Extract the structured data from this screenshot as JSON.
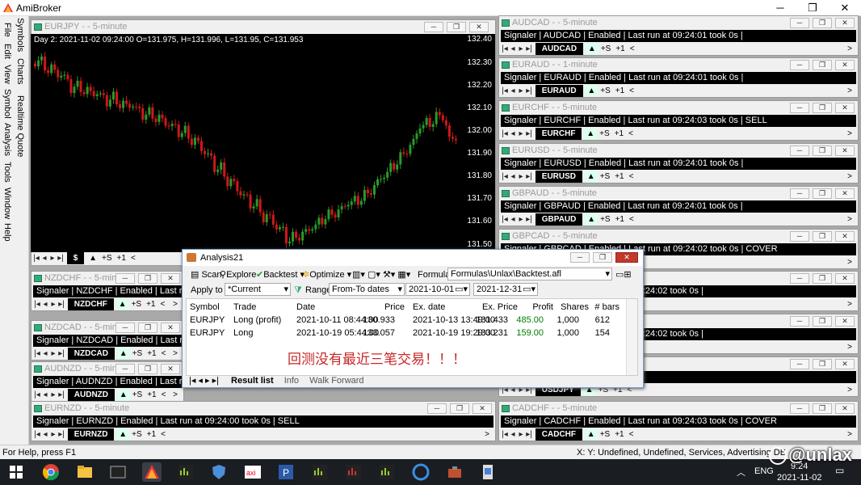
{
  "app": {
    "title": "AmiBroker"
  },
  "sidebar": {
    "tabs": [
      "Symbols",
      "Charts",
      "Realtime Quote"
    ],
    "menu": [
      "File",
      "Edit",
      "View",
      "Symbol",
      "Analysis",
      "Tools",
      "Window",
      "Help"
    ]
  },
  "main_chart": {
    "caption": "EURJPY - - 5-minute",
    "info": "Day 2: 2021-11-02 09:24:00 O=131.975, H=131.996, L=131.95, C=131.953",
    "yticks": [
      "132.40",
      "132.30",
      "132.20",
      "132.10",
      "132.00",
      "131.90",
      "131.80",
      "131.70",
      "131.60",
      "131.50"
    ],
    "nav_symbol": "$"
  },
  "chart_data": {
    "type": "candlestick",
    "title": "EURJPY - - 5-minute",
    "ylim": [
      131.47,
      132.43
    ],
    "close_path": [
      132.3,
      132.33,
      132.25,
      132.3,
      132.22,
      132.26,
      132.18,
      132.22,
      132.16,
      132.2,
      132.14,
      132.18,
      132.12,
      132.17,
      132.1,
      132.14,
      132.09,
      132.12,
      132.06,
      132.1,
      132.04,
      132.08,
      132.0,
      132.05,
      131.98,
      132.02,
      131.94,
      131.98,
      131.88,
      131.92,
      131.82,
      131.86,
      131.76,
      131.8,
      131.7,
      131.74,
      131.66,
      131.7,
      131.6,
      131.65,
      131.55,
      131.6,
      131.5,
      131.56,
      131.52,
      131.58,
      131.55,
      131.62,
      131.6,
      131.66,
      131.62,
      131.68,
      131.66,
      131.72,
      131.68,
      131.75,
      131.72,
      131.8,
      131.78,
      131.86,
      131.84,
      131.92,
      131.9,
      131.98,
      132.0,
      132.06,
      132.02,
      132.1,
      132.04,
      131.98,
      131.95
    ]
  },
  "symbol_windows": [
    {
      "caption": "AUDCAD - - 5-minute",
      "signal": "Signaler | AUDCAD | Enabled | Last run at 09:24:01 took 0s |",
      "sym": "AUDCAD"
    },
    {
      "caption": "EURAUD - - 1-minute",
      "signal": "Signaler | EURAUD | Enabled | Last run at 09:24:01 took 0s |",
      "sym": "EURAUD"
    },
    {
      "caption": "EURCHF - - 5-minute",
      "signal": "Signaler | EURCHF | Enabled | Last run at 09:24:03 took 0s |   SELL",
      "sym": "EURCHF"
    },
    {
      "caption": "EURUSD - - 5-minute",
      "signal": "Signaler | EURUSD | Enabled | Last run at 09:24:01 took 0s |",
      "sym": "EURUSD"
    },
    {
      "caption": "GBPAUD - - 5-minute",
      "signal": "Signaler | GBPAUD | Enabled | Last run at 09:24:01 took 0s |",
      "sym": "GBPAUD"
    },
    {
      "caption": "GBPCAD - - 5-minute",
      "signal": "Signaler | GBPCAD | Enabled | Last run at 09:24:02 took 0s |   COVER",
      "sym": "GBPCAD"
    },
    {
      "caption": "",
      "signal": "Signaler | | Enabled | Last run at 09:24:02 took 0s |",
      "sym": ""
    },
    {
      "caption": "",
      "signal": "Signaler | | Enabled | Last run at 09:24:02 took 0s |",
      "sym": ""
    },
    {
      "caption": "",
      "signal": "at 09:24:00 took 0s |",
      "sym": "USDJPY"
    },
    {
      "caption": "CADCHF - - 5-minute",
      "signal": "Signaler | CADCHF | Enabled | Last run at 09:24:03 took 0s |   COVER",
      "sym": "CADCHF"
    }
  ],
  "left_windows": [
    {
      "caption": "NZDCHF - - 5-minute",
      "signal": "Signaler | NZDCHF | Enabled | Last run",
      "sym": "NZDCHF"
    },
    {
      "caption": "NZDCAD - - 5-minute",
      "signal": "Signaler | NZDCAD | Enabled | Last run",
      "sym": "NZDCAD"
    },
    {
      "caption": "AUDNZD - - 5-minute",
      "signal": "Signaler | AUDNZD | Enabled | Last run",
      "sym": "AUDNZD"
    },
    {
      "caption": "EURNZD - - 5-minute",
      "signal": "Signaler | EURNZD | Enabled | Last run at 09:24:00 took 0s |   SELL",
      "sym": "EURNZD"
    }
  ],
  "nav_labels": {
    "s": "+S",
    "one": "+1"
  },
  "analysis": {
    "title": "Analysis21",
    "toolbar": {
      "scan": "Scan",
      "explore": "Explore",
      "backtest": "Backtest",
      "optimize": "Optimize",
      "formula_label": "Formula",
      "formula_value": "Formulas\\Unlax\\Backtest.afl"
    },
    "apply_label": "Apply to",
    "apply_value": "*Current",
    "range_label": "Range",
    "range_value": "From-To dates",
    "from_date": "2021-10-01",
    "to_date": "2021-12-31",
    "columns": [
      "Symbol",
      "Trade",
      "Date",
      "Price",
      "Ex. date",
      "Ex. Price",
      "Profit",
      "Shares",
      "# bars"
    ],
    "rows": [
      [
        "EURJPY",
        "Long (profit)",
        "2021-10-11 08:44:00",
        "130.933",
        "2021-10-13 13:49:00",
        "131.433",
        "485.00",
        "1,000",
        "612"
      ],
      [
        "EURJPY",
        "Long",
        "2021-10-19 05:44:00",
        "133.057",
        "2021-10-19 19:29:00",
        "133.231",
        "159.00",
        "1,000",
        "154"
      ]
    ],
    "note": "回测没有最近三笔交易！！！",
    "tabs": [
      "Result list",
      "Info",
      "Walk Forward"
    ]
  },
  "status": {
    "left": "For Help, press F1",
    "right": "X: Y: Undefined, Undefined, Services, Advertising  DB"
  },
  "taskbar": {
    "lang": "ENG",
    "date": "2021-11-02",
    "time": "9:24"
  },
  "watermark": "@unlax",
  "colors": {
    "up": "#2a9a2a",
    "down": "#d01818",
    "profit": "#008000"
  }
}
